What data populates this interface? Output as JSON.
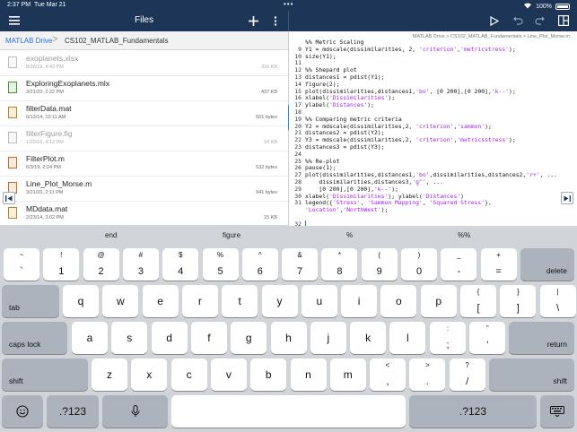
{
  "status": {
    "time": "2:37 PM",
    "date": "Tue Mar 21",
    "dots": "•••",
    "battery": "100%"
  },
  "nav": {
    "title": "Files",
    "menu_icon": "hamburger-icon",
    "add_icon": "plus-icon",
    "more_icon": "ellipsis-vertical-icon",
    "run_icon": "play-icon",
    "undo_icon": "undo-icon",
    "redo_icon": "redo-icon",
    "layout_icon": "layout-grid-icon"
  },
  "breadcrumb": {
    "root": "MATLAB Drive",
    "separator": ">",
    "folder": "CS102_MATLAB_Fundamentals"
  },
  "files": [
    {
      "name": "exoplanets.xlsx",
      "date": "8/26/19, 4:43 PM",
      "size": "316 KB",
      "dim": true,
      "kind": "xlsx"
    },
    {
      "name": "ExploringExoplanets.mlx",
      "date": "3/21/23, 2:22 PM",
      "size": "437 KB",
      "dim": false,
      "kind": "mlx"
    },
    {
      "name": "filterData.mat",
      "date": "6/13/14, 10:11 AM",
      "size": "501 bytes",
      "dim": false,
      "kind": "mat"
    },
    {
      "name": "filterFigure.fig",
      "date": "1/20/16, 4:12 PM",
      "size": "18 KB",
      "dim": true,
      "kind": "fig"
    },
    {
      "name": "FilterPlot.m",
      "date": "6/3/19, 2:24 PM",
      "size": "532 bytes",
      "dim": false,
      "kind": "m"
    },
    {
      "name": "Line_Plot_Morse.m",
      "date": "3/21/23, 2:11 PM",
      "size": "941 bytes",
      "dim": false,
      "kind": "m"
    },
    {
      "name": "MDdata.mat",
      "date": "2/23/14, 3:02 PM",
      "size": "15 KB",
      "dim": false,
      "kind": "mat"
    }
  ],
  "editor": {
    "path": "MATLAB Drive > CS102_MATLAB_Fundamentals > Line_Plot_Morse.m",
    "lines": [
      {
        "n": "",
        "t": "%% Metric Scaling",
        "k": "cm"
      },
      {
        "n": "9",
        "t": "Y1 = mdscale(dissimilarities, 2, 'criterion','metricstress');",
        "k": "code"
      },
      {
        "n": "10",
        "t": "size(Y1);",
        "k": "code"
      },
      {
        "n": "11",
        "t": "",
        "k": "code"
      },
      {
        "n": "12",
        "t": "%% Shepard plot",
        "k": "cm"
      },
      {
        "n": "13",
        "t": "distances1 = pdist(Y1);",
        "k": "code"
      },
      {
        "n": "14",
        "t": "figure(2);",
        "k": "code"
      },
      {
        "n": "15",
        "t": "plot(dissimilarities,distances1,'bo', [0 200],[0 200],'k--');",
        "k": "code"
      },
      {
        "n": "16",
        "t": "xlabel('Dissimilarities');",
        "k": "code"
      },
      {
        "n": "17",
        "t": "ylabel('Distances');",
        "k": "code"
      },
      {
        "n": "18",
        "t": "",
        "k": "code"
      },
      {
        "n": "19",
        "t": "%% Comparing metric criteria",
        "k": "cm"
      },
      {
        "n": "20",
        "t": "Y2 = mdscale(dissimilarities,2, 'criterion','sammon');",
        "k": "code"
      },
      {
        "n": "21",
        "t": "distances2 = pdist(Y2);",
        "k": "code"
      },
      {
        "n": "22",
        "t": "Y3 = mdscale(dissimilarities,2, 'criterion','metricsstress');",
        "k": "code"
      },
      {
        "n": "23",
        "t": "distances3 = pdist(Y3);",
        "k": "code"
      },
      {
        "n": "24",
        "t": "",
        "k": "code"
      },
      {
        "n": "25",
        "t": "%% Re-plot",
        "k": "cm"
      },
      {
        "n": "26",
        "t": "pause(1);",
        "k": "code"
      },
      {
        "n": "27",
        "t": "plot(dissimilarities,distances1,'bo',dissimilarities,distances2,'r+', ...",
        "k": "code"
      },
      {
        "n": "28",
        "t": "    dissimilarities,distances3,'g^', ...",
        "k": "code"
      },
      {
        "n": "29",
        "t": "    [0 200],[0 200],'k--');",
        "k": "code"
      },
      {
        "n": "30",
        "t": "xlabel('Dissimilarities'); ylabel('Distances')",
        "k": "code"
      },
      {
        "n": "31",
        "t": "legend({'Stress', 'Sammon Mapping', 'Squared Stress'},",
        "k": "code"
      },
      {
        "n": "",
        "t": "'Location','NorthWest');",
        "k": "code"
      },
      {
        "n": "",
        "t": "",
        "k": "code"
      },
      {
        "n": "32",
        "t": "",
        "k": "code"
      }
    ]
  },
  "collapse_left_icon": "collapse-left-icon",
  "collapse_right_icon": "collapse-right-icon",
  "suggestions": [
    "end",
    "figure",
    "%",
    "%%"
  ],
  "keyboard": {
    "row1": [
      {
        "top": "~",
        "bot": "`"
      },
      {
        "top": "!",
        "bot": "1"
      },
      {
        "top": "@",
        "bot": "2"
      },
      {
        "top": "#",
        "bot": "3"
      },
      {
        "top": "$",
        "bot": "4"
      },
      {
        "top": "%",
        "bot": "5"
      },
      {
        "top": "^",
        "bot": "6"
      },
      {
        "top": "&",
        "bot": "7"
      },
      {
        "top": "*",
        "bot": "8"
      },
      {
        "top": "(",
        "bot": "9"
      },
      {
        "top": ")",
        "bot": "0"
      },
      {
        "top": "_",
        "bot": "-"
      },
      {
        "top": "+",
        "bot": "="
      }
    ],
    "delete": "delete",
    "tab": "tab",
    "row2": [
      "q",
      "w",
      "e",
      "r",
      "t",
      "y",
      "u",
      "i",
      "o",
      "p"
    ],
    "row2_extra": [
      {
        "top": "{",
        "bot": "["
      },
      {
        "top": "}",
        "bot": "]"
      },
      {
        "top": "|",
        "bot": "\\"
      }
    ],
    "caps": "caps lock",
    "row3": [
      "a",
      "s",
      "d",
      "f",
      "g",
      "h",
      "j",
      "k",
      "l"
    ],
    "row3_extra": [
      {
        "top": ":",
        "bot": ";"
      },
      {
        "top": "\"",
        "bot": "'"
      }
    ],
    "return": "return",
    "shift": "shift",
    "row4": [
      "z",
      "x",
      "c",
      "v",
      "b",
      "n",
      "m"
    ],
    "row4_extra": [
      {
        "top": "<",
        "bot": ","
      },
      {
        "top": ">",
        "bot": "."
      },
      {
        "top": "?",
        "bot": "/"
      }
    ],
    "numkey": ".?123",
    "emoji_icon": "emoji-icon",
    "mic_icon": "microphone-icon",
    "hide_icon": "keyboard-hide-icon"
  }
}
